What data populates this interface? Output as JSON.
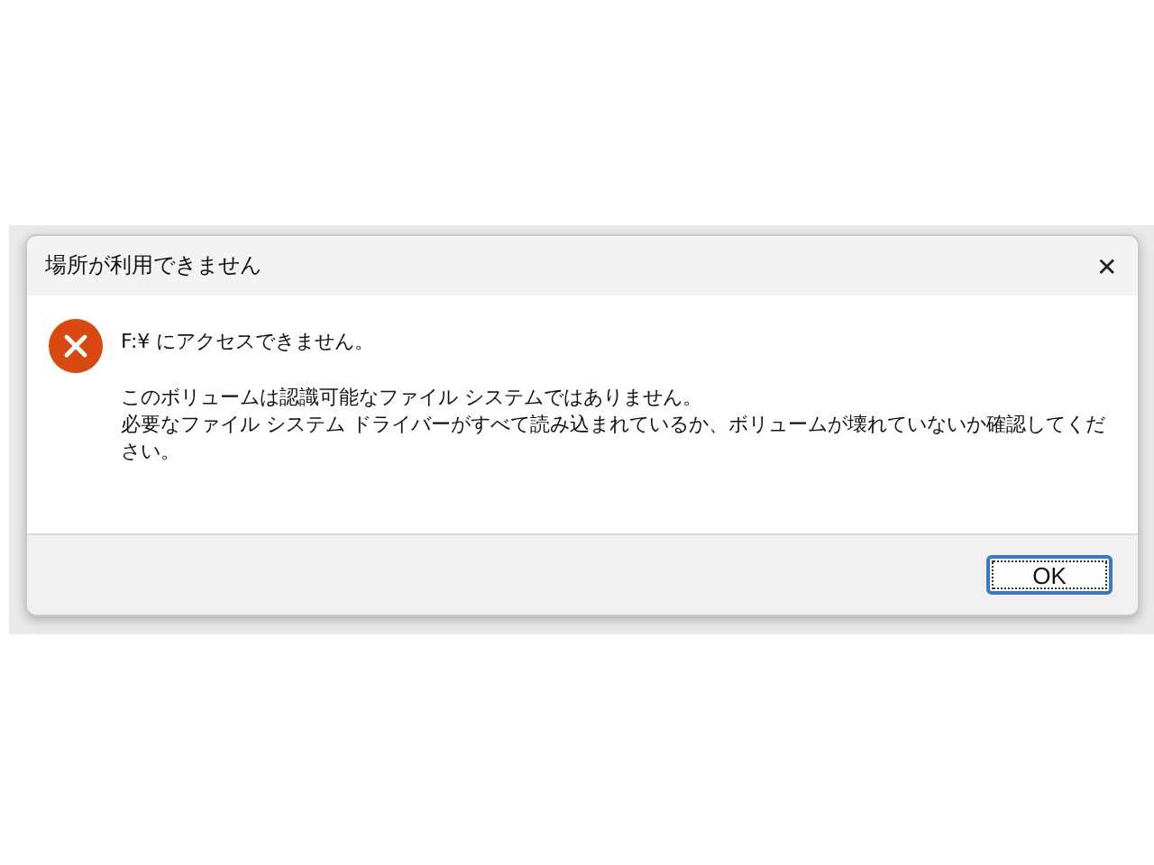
{
  "window": {
    "title": "場所が利用できません",
    "close": "✕"
  },
  "message": {
    "heading": "F:¥ にアクセスできません。",
    "lines": [
      "このボリュームは認識可能なファイル システムではありません。",
      "必要なファイル システム ドライバーがすべて読み込まれているか、ボリュームが壊れていないか確認してください。"
    ]
  },
  "buttons": [
    {
      "label": "OK",
      "default": true
    }
  ]
}
